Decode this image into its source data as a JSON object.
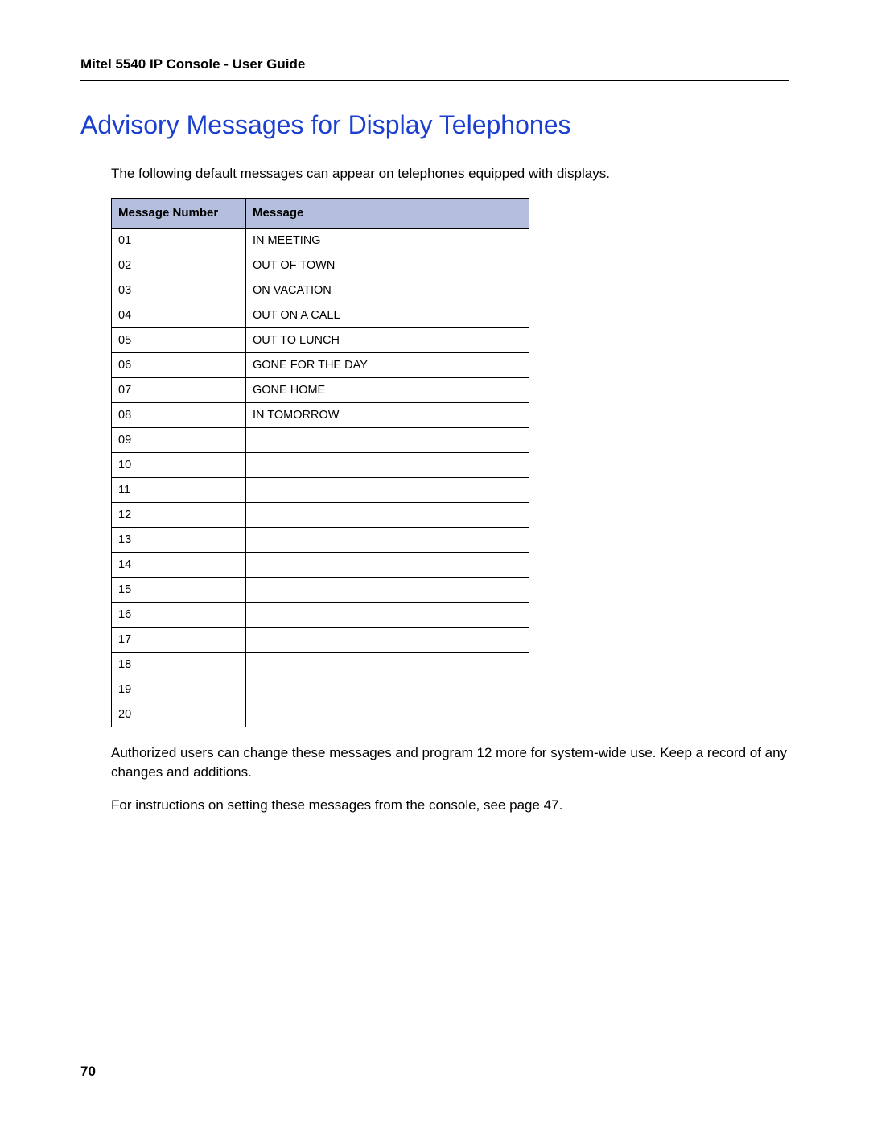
{
  "header": {
    "running_title": "Mitel 5540 IP Console - User Guide"
  },
  "title": "Advisory Messages for Display Telephones",
  "intro": "The following default messages can appear on telephones equipped with displays.",
  "table": {
    "columns": {
      "number": "Message Number",
      "message": "Message"
    },
    "rows": [
      {
        "number": "01",
        "message": "IN MEETING"
      },
      {
        "number": "02",
        "message": "OUT OF TOWN"
      },
      {
        "number": "03",
        "message": "ON VACATION"
      },
      {
        "number": "04",
        "message": "OUT ON A CALL"
      },
      {
        "number": "05",
        "message": "OUT TO LUNCH"
      },
      {
        "number": "06",
        "message": "GONE FOR THE DAY"
      },
      {
        "number": "07",
        "message": "GONE HOME"
      },
      {
        "number": "08",
        "message": "IN TOMORROW"
      },
      {
        "number": "09",
        "message": ""
      },
      {
        "number": "10",
        "message": ""
      },
      {
        "number": "11",
        "message": ""
      },
      {
        "number": "12",
        "message": ""
      },
      {
        "number": "13",
        "message": ""
      },
      {
        "number": "14",
        "message": ""
      },
      {
        "number": "15",
        "message": ""
      },
      {
        "number": "16",
        "message": ""
      },
      {
        "number": "17",
        "message": ""
      },
      {
        "number": "18",
        "message": ""
      },
      {
        "number": "19",
        "message": ""
      },
      {
        "number": "20",
        "message": ""
      }
    ]
  },
  "paragraphs": {
    "p1": "Authorized users can change these messages and program 12 more for system-wide use. Keep a record of any changes and additions.",
    "p2": "For instructions on setting these messages from the console, see page 47."
  },
  "page_number": "70"
}
